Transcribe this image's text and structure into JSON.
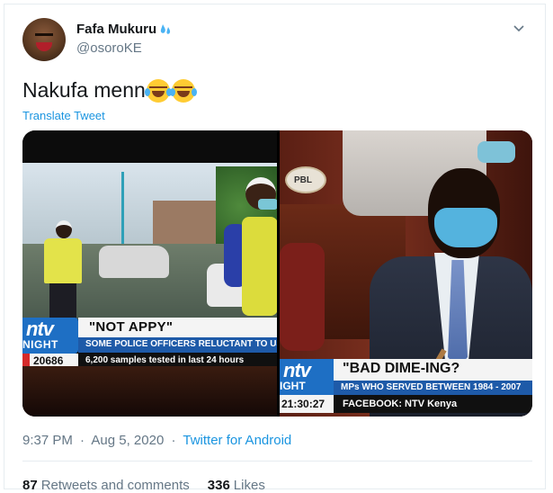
{
  "author": {
    "display_name": "Fafa Mukuru",
    "handle": "@osoroKE"
  },
  "tweet": {
    "text": "Nakufa menn",
    "emoji": [
      "face-with-tears-of-joy",
      "face-with-tears-of-joy"
    ],
    "translate_label": "Translate Tweet"
  },
  "media": {
    "left": {
      "logo_ntv": "ntv",
      "logo_night": "NIGHT",
      "headline": "\"NOT APPY\"",
      "subheadline": "SOME POLICE OFFICERS RELUCTANT TO USE DI",
      "count": "20686",
      "ticker": "6,200 samples tested in last 24 hours"
    },
    "right": {
      "sign": "PBL",
      "logo_ntv": "ntv",
      "logo_night": "IGHT",
      "headline": "\"BAD DIME-ING?",
      "subheadline": "MPs WHO SERVED BETWEEN 1984 - 2007",
      "time": "21:30:27",
      "facebook": "FACEBOOK: NTV Kenya"
    }
  },
  "meta": {
    "time": "9:37 PM",
    "separator": "·",
    "date": "Aug 5, 2020",
    "app": "Twitter for Android"
  },
  "stats": {
    "retweets_count": "87",
    "retweets_label": "Retweets and comments",
    "likes_count": "336",
    "likes_label": "Likes"
  },
  "colors": {
    "link": "#1b95e0",
    "muted": "#657786",
    "text": "#14171a",
    "ntv_blue": "#1e6fc4"
  }
}
